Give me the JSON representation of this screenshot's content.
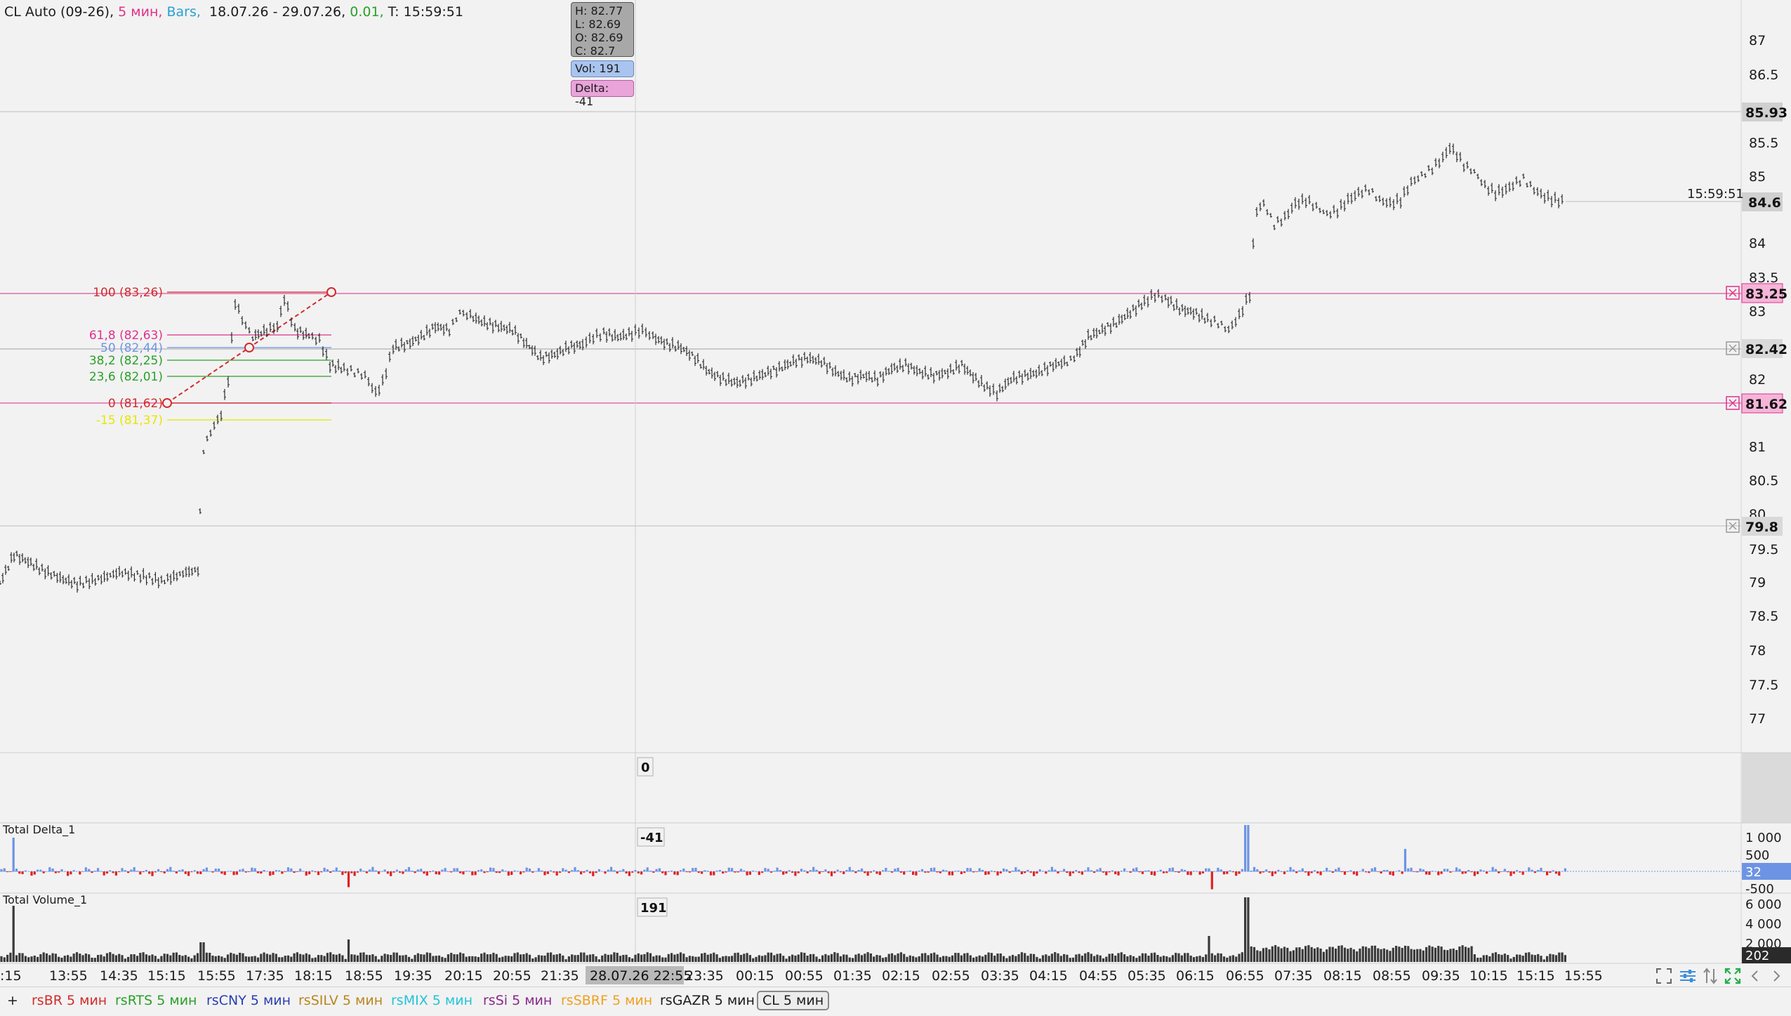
{
  "header": {
    "symbol": "CL Auto (09-26),",
    "timeframe": "5 мин,",
    "chart_type": "Bars,",
    "range": "18.07.26 - 29.07.26,",
    "tick": "0.01,",
    "time": "T: 15:59:51",
    "colors": {
      "timeframe": "#e0308a",
      "chart_type": "#2aa0d0",
      "tick": "#2aa02a"
    }
  },
  "tooltip": {
    "high": "H: 82.77",
    "low": "L: 82.69",
    "open": "O: 82.69",
    "close": "C: 82.7",
    "volume": "Vol: 191",
    "delta": "Delta: -41"
  },
  "crosshair": {
    "time_label": "28.07.26 22:55",
    "delta_value": "-41",
    "volume_value": "191",
    "zero_value": "0"
  },
  "price_axis": {
    "ticks": [
      "87",
      "86.5",
      "85.5",
      "85",
      "84",
      "83.5",
      "83",
      "82",
      "81",
      "80.5",
      "80",
      "79.5",
      "79",
      "78.5",
      "78",
      "77.5",
      "77"
    ],
    "labels": {
      "level_top": "85.93",
      "last": "84.6",
      "fib_100": "83.25",
      "fib_50": "82.42",
      "fib_0": "81.62",
      "level_low": "79.8"
    },
    "last_time": "15:59:51"
  },
  "fibonacci": {
    "levels": [
      {
        "label": "100 (83,26)",
        "color": "#d22b2b"
      },
      {
        "label": "61,8 (82,63)",
        "color": "#e0308a"
      },
      {
        "label": "50 (82,44)",
        "color": "#6d94e4"
      },
      {
        "label": "38,2 (82,25)",
        "color": "#2aa02a"
      },
      {
        "label": "23,6 (82,01)",
        "color": "#2aa02a"
      },
      {
        "label": "0 (81,62)",
        "color": "#d22b2b"
      },
      {
        "label": "-15 (81,37)",
        "color": "#e6e600"
      }
    ]
  },
  "time_axis": {
    "labels": [
      ":15",
      "13:55",
      "14:35",
      "15:15",
      "15:55",
      "17:35",
      "18:15",
      "18:55",
      "19:35",
      "20:15",
      "20:55",
      "21:35",
      "22:",
      "23:35",
      "00:15",
      "00:55",
      "01:35",
      "02:15",
      "02:55",
      "03:35",
      "04:15",
      "04:55",
      "05:35",
      "06:15",
      "06:55",
      "07:35",
      "08:15",
      "08:55",
      "09:35",
      "10:15",
      "15:15",
      "15:55"
    ]
  },
  "indicators": {
    "delta": {
      "title": "Total Delta_1",
      "ticks": [
        "1 000",
        "500",
        "-500"
      ],
      "last": "32"
    },
    "volume": {
      "title": "Total Volume_1",
      "ticks": [
        "6 000",
        "4 000",
        "2 000"
      ],
      "last": "202"
    }
  },
  "tabs": [
    {
      "label": "+",
      "color": "#1c1c1c"
    },
    {
      "label": "rsBR 5 мин",
      "color": "#d22b2b"
    },
    {
      "label": "rsRTS 5 мин",
      "color": "#2aa02a"
    },
    {
      "label": "rsCNY 5 мин",
      "color": "#2b3fb0"
    },
    {
      "label": "rsSILV 5 мин",
      "color": "#b8861e"
    },
    {
      "label": "rsMIX 5 мин",
      "color": "#22c4d8"
    },
    {
      "label": "rsSi 5 мин",
      "color": "#8a2a8a"
    },
    {
      "label": "rsSBRF 5 мин",
      "color": "#f0a020"
    },
    {
      "label": "rsGAZR 5 мин",
      "color": "#1c1c1c"
    },
    {
      "label": "CL 5 мин",
      "color": "#1c1c1c",
      "active": true
    }
  ],
  "toolbar_icons": [
    "fullscreen-icon",
    "settings-sliders-icon",
    "scale-arrows-icon",
    "expand-icon",
    "scroll-left-icon",
    "scroll-right-icon"
  ]
}
